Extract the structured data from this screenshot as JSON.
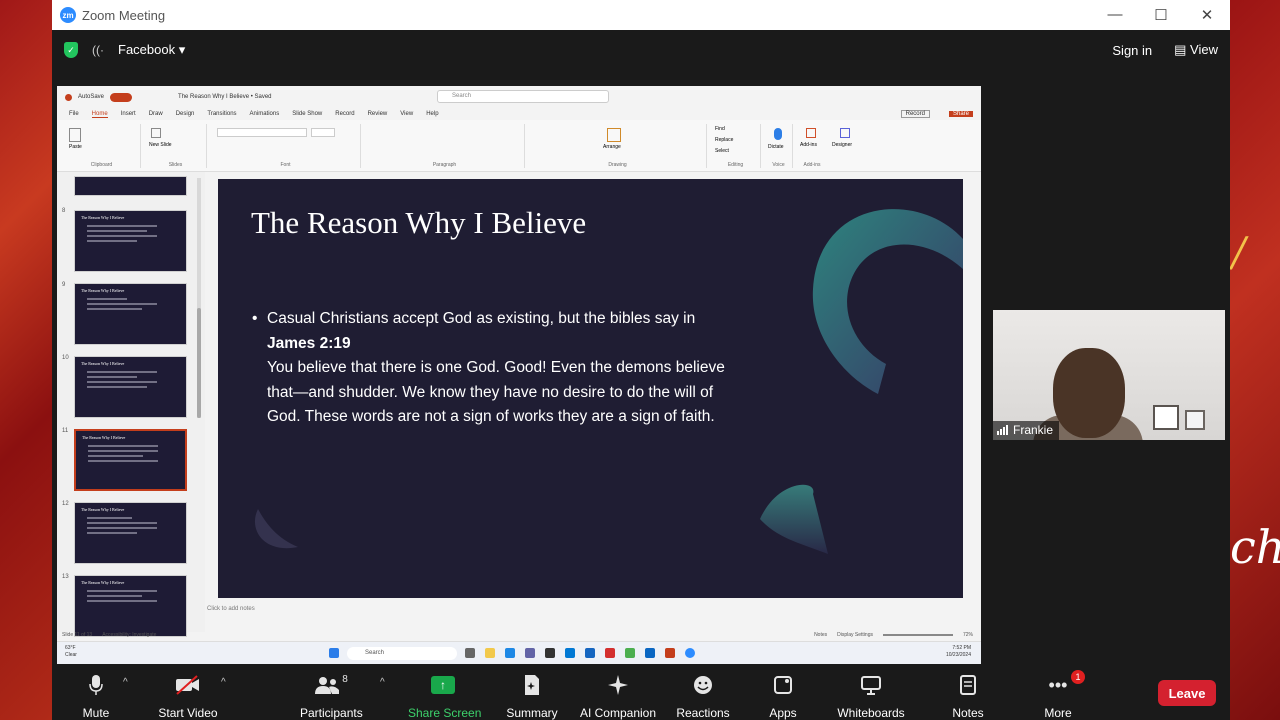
{
  "window": {
    "title": "Zoom Meeting",
    "minimize": "—",
    "maximize": "☐",
    "close": "✕"
  },
  "meeting": {
    "host_app": "Facebook",
    "sign_in": "Sign in",
    "view": "View"
  },
  "powerpoint": {
    "doc_title": "The Reason Why I Believe • Saved",
    "autosave": "AutoSave",
    "search_placeholder": "Search",
    "menu": [
      "File",
      "Home",
      "Insert",
      "Draw",
      "Design",
      "Transitions",
      "Animations",
      "Slide Show",
      "Record",
      "Review",
      "View",
      "Help"
    ],
    "record": "Record",
    "share": "Share",
    "ribbon_groups": [
      "Clipboard",
      "Slides",
      "Font",
      "Paragraph",
      "Drawing",
      "Editing",
      "Voice",
      "Add-ins"
    ],
    "ribbon_labels": {
      "paste": "Paste",
      "new_slide": "New Slide",
      "find": "Find",
      "replace": "Replace",
      "select": "Select",
      "dictate": "Dictate",
      "addins": "Add-ins",
      "designer": "Designer",
      "arrange": "Arrange"
    },
    "thumbnails": [
      {
        "num": "8",
        "title": "The Reason Why I Believe"
      },
      {
        "num": "9",
        "title": "The Reason Why I Believe"
      },
      {
        "num": "10",
        "title": "The Reason Why I Believe"
      },
      {
        "num": "11",
        "title": "The Reason Why I Believe"
      },
      {
        "num": "12",
        "title": "The Reason Why I Believe"
      },
      {
        "num": "13",
        "title": "The Reason Why I Believe"
      }
    ],
    "slide": {
      "title": "The Reason Why I Believe",
      "line1": "Casual Christians accept God as existing, but the bibles say in",
      "verse": "James 2:19",
      "line2": "You believe that there is one God. Good! Even the demons believe that—and shudder. We know they have no desire to do the will of God. These words are not a sign of works they are a sign of faith."
    },
    "notes_placeholder": "Click to add notes",
    "status": {
      "slide_count": "Slide 11 of 13",
      "accessibility": "Accessibility: Investigate",
      "notes": "Notes",
      "display": "Display Settings",
      "zoom": "72%"
    },
    "taskbar": {
      "search": "Search",
      "weather_temp": "63°F",
      "weather_desc": "Clear",
      "time": "7:52 PM",
      "date": "10/23/2024"
    }
  },
  "participant": {
    "name": "Frankie"
  },
  "toolbar": {
    "mute": "Mute",
    "start_video": "Start Video",
    "participants": "Participants",
    "participants_count": "8",
    "share_screen": "Share Screen",
    "summary": "Summary",
    "ai_companion": "AI Companion",
    "reactions": "Reactions",
    "apps": "Apps",
    "whiteboards": "Whiteboards",
    "notes": "Notes",
    "more": "More",
    "more_badge": "1",
    "leave": "Leave"
  },
  "colors": {
    "accent": "#c43e1c",
    "slide_bg": "#1f1d33",
    "leave": "#d4212f",
    "share_green": "#19a84b"
  }
}
